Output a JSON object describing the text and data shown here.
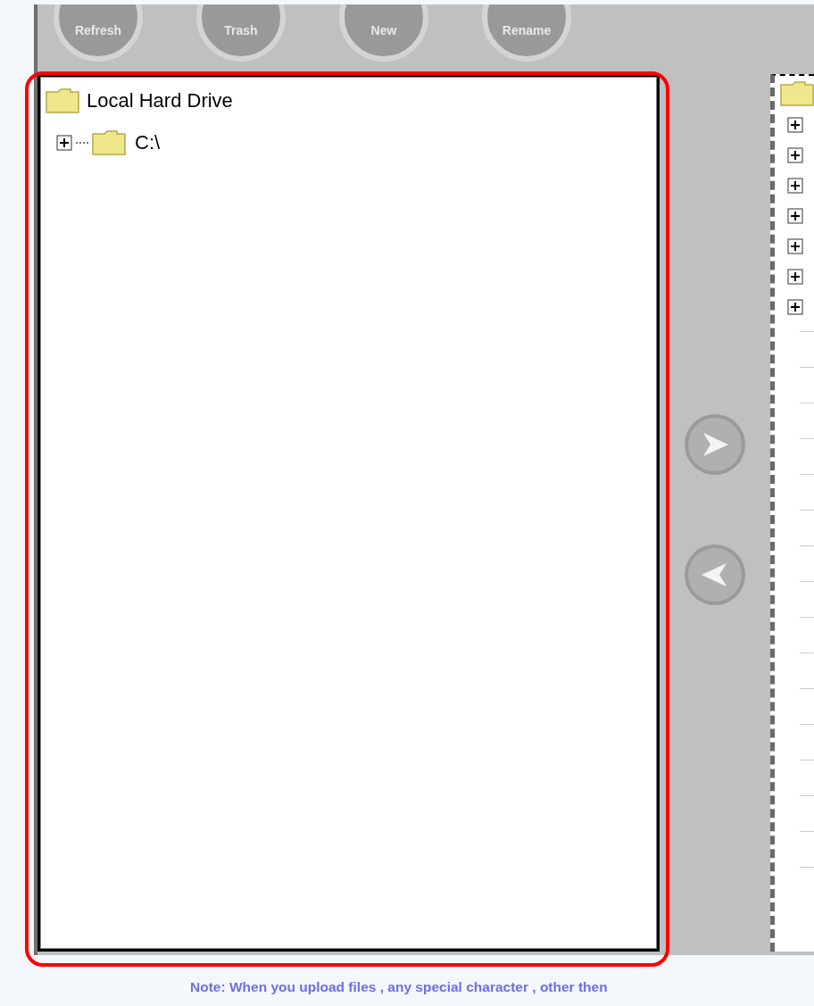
{
  "toolbar": {
    "buttons": [
      {
        "label": "Refresh"
      },
      {
        "label": "Trash"
      },
      {
        "label": "New"
      },
      {
        "label": "Rename"
      }
    ]
  },
  "local_tree": {
    "items": [
      {
        "label": "Local Hard Drive",
        "children": [
          {
            "label": "C:\\",
            "expanded": false
          }
        ]
      }
    ]
  },
  "remote_tree": {
    "items": [
      {
        "expanded": false
      },
      {
        "expanded": false
      },
      {
        "expanded": false
      },
      {
        "expanded": false
      },
      {
        "expanded": false
      },
      {
        "expanded": false
      },
      {
        "expanded": false
      }
    ]
  },
  "note": "Note: When you upload files , any special character , other then"
}
